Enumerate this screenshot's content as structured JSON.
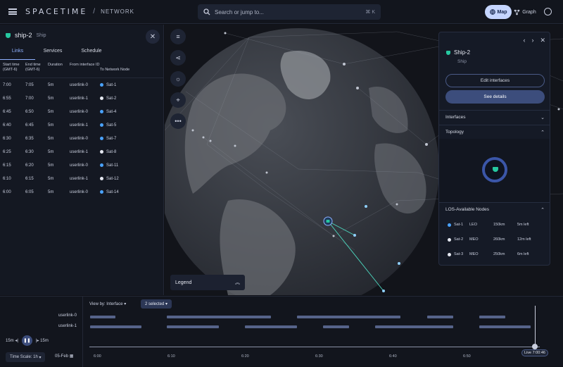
{
  "topbar": {
    "brand": "SPACETIME",
    "separator": "/",
    "section": "NETWORK",
    "search_placeholder": "Search or jump to...",
    "search_shortcut": "⌘ K",
    "map_label": "Map",
    "graph_label": "Graph"
  },
  "left": {
    "entity_name": "ship-2",
    "entity_type": "Ship",
    "tabs": [
      "Links",
      "Services",
      "Schedule"
    ],
    "columns": [
      "Start time (GMT-6)",
      "End time (GMT-6)",
      "Duration",
      "From interface ID",
      "To Network Node"
    ],
    "rows": [
      {
        "start": "7:00",
        "end": "7:05",
        "dur": "5m",
        "from": "userlink-0",
        "to": "Sat-1",
        "color": "#4aa3ff"
      },
      {
        "start": "6:55",
        "end": "7:00",
        "dur": "5m",
        "from": "userlink-1",
        "to": "Sat-2",
        "color": "#e6e9f2"
      },
      {
        "start": "6:45",
        "end": "6:50",
        "dur": "5m",
        "from": "userlink-0",
        "to": "Sat-4",
        "color": "#4aa3ff"
      },
      {
        "start": "6:40",
        "end": "6:45",
        "dur": "5m",
        "from": "userlink-1",
        "to": "Sat-5",
        "color": "#4aa3ff"
      },
      {
        "start": "6:30",
        "end": "6:35",
        "dur": "5m",
        "from": "userlink-0",
        "to": "Sat-7",
        "color": "#4aa3ff"
      },
      {
        "start": "6:25",
        "end": "6:30",
        "dur": "5m",
        "from": "userlink-1",
        "to": "Sat-8",
        "color": "#e6e9f2"
      },
      {
        "start": "6:15",
        "end": "6:20",
        "dur": "5m",
        "from": "userlink-0",
        "to": "Sat-11",
        "color": "#4aa3ff"
      },
      {
        "start": "6:10",
        "end": "6:15",
        "dur": "5m",
        "from": "userlink-1",
        "to": "Sat-12",
        "color": "#e6e9f2"
      },
      {
        "start": "6:00",
        "end": "6:05",
        "dur": "5m",
        "from": "userlink-0",
        "to": "Sat-14",
        "color": "#4aa3ff"
      }
    ]
  },
  "map": {
    "legend_label": "Legend"
  },
  "detail": {
    "title": "Ship-2",
    "subtitle": "Ship",
    "edit_label": "Edit interfaces",
    "details_label": "See details",
    "interfaces_label": "Interfaces",
    "topology_label": "Topology",
    "los_label": "LOS-Available Nodes",
    "los_rows": [
      {
        "name": "Sat-1",
        "orbit": "LEO",
        "dist": "150km",
        "left": "5m left",
        "color": "#4aa3ff"
      },
      {
        "name": "Sat-2",
        "orbit": "MEO",
        "dist": "260km",
        "left": "12m left",
        "color": "#e6e9f2"
      },
      {
        "name": "Sat-3",
        "orbit": "MEO",
        "dist": "250km",
        "left": "6m left",
        "color": "#e6e9f2"
      }
    ]
  },
  "timeline": {
    "view_by": "View by: Interface",
    "selected": "2 selected",
    "tracks": [
      "userlink-0",
      "userlink-1"
    ],
    "back_label": "15m",
    "fwd_label": "15m",
    "scale_label": "Time Scale: 1h",
    "date_label": "05-Feb",
    "ticks": [
      "6:00",
      "6:10",
      "6:20",
      "6:30",
      "6:40",
      "6:50"
    ],
    "live_label": "Live 7:00:46"
  }
}
